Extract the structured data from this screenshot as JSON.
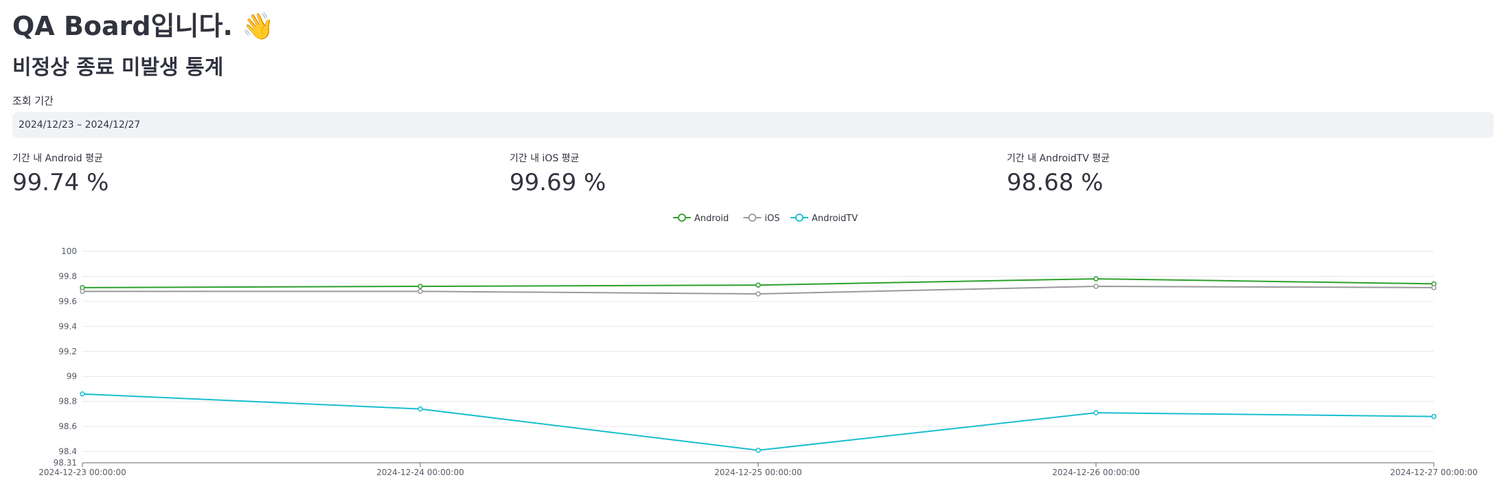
{
  "header": {
    "title": "QA Board입니다. 👋",
    "subtitle": "비정상 종료 미발생 통계"
  },
  "filter": {
    "label": "조회 기간",
    "date_range": "2024/12/23 – 2024/12/27"
  },
  "metrics": [
    {
      "label": "기간 내 Android 평균",
      "value": "99.74 %"
    },
    {
      "label": "기간 내 iOS 평균",
      "value": "99.69 %"
    },
    {
      "label": "기간 내 AndroidTV 평균",
      "value": "98.68 %"
    }
  ],
  "chart_data": {
    "type": "line",
    "x": [
      "2024-12-23 00:00:00",
      "2024-12-24 00:00:00",
      "2024-12-25 00:00:00",
      "2024-12-26 00:00:00",
      "2024-12-27 00:00:00"
    ],
    "series": [
      {
        "name": "Android",
        "color": "#2ca02c",
        "values": [
          99.71,
          99.72,
          99.73,
          99.78,
          99.74
        ]
      },
      {
        "name": "iOS",
        "color": "#999999",
        "values": [
          99.68,
          99.68,
          99.66,
          99.72,
          99.71
        ]
      },
      {
        "name": "AndroidTV",
        "color": "#17becf",
        "values": [
          98.86,
          98.74,
          98.41,
          98.71,
          98.68
        ]
      }
    ],
    "ylim": [
      98.31,
      100
    ],
    "yticks": [
      "98.31",
      "98.4",
      "98.6",
      "98.8",
      "99",
      "99.2",
      "99.4",
      "99.6",
      "99.8",
      "100"
    ],
    "grid": true,
    "legend": "top-center"
  }
}
